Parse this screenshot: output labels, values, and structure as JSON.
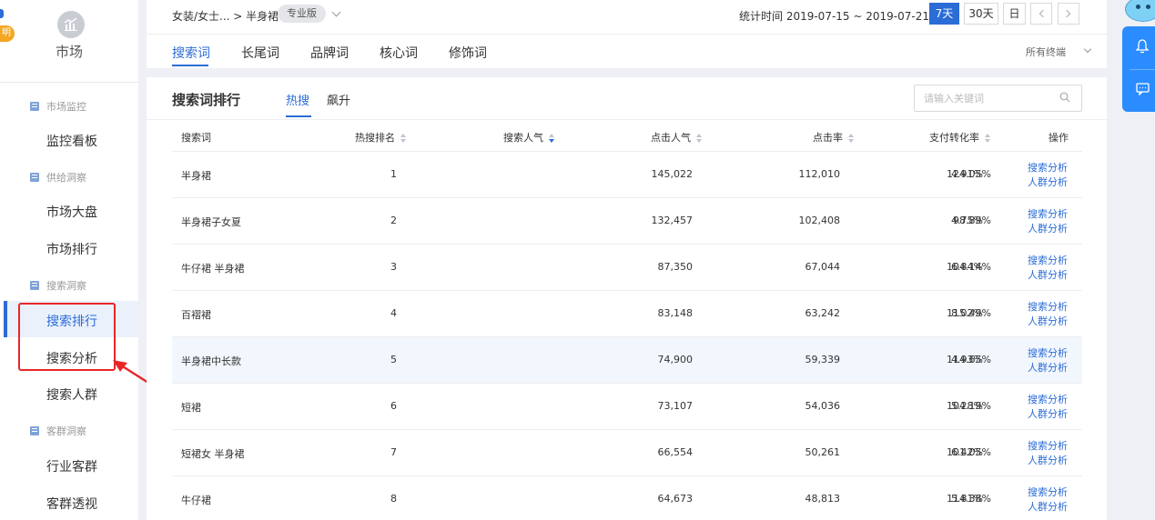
{
  "sidebar": {
    "badge": "明",
    "market_label": "市场",
    "groups": [
      "市场监控",
      "供给洞察",
      "搜索洞察",
      "客群洞察"
    ],
    "items": [
      "监控看板",
      "市场大盘",
      "市场排行",
      "搜索排行",
      "搜索分析",
      "搜索人群",
      "行业客群",
      "客群透视"
    ],
    "active_item": "搜索排行"
  },
  "header": {
    "breadcrumb": "女装/女士... > 半身裙",
    "edition": "专业版",
    "stat_time": "统计时间 2019-07-15 ~ 2019-07-21",
    "ranges": [
      "7天",
      "30天",
      "日"
    ],
    "active_range": "7天",
    "tabs": [
      "搜索词",
      "长尾词",
      "品牌词",
      "核心词",
      "修饰词"
    ],
    "active_tab": "搜索词",
    "terminals": "所有终端"
  },
  "panel": {
    "title": "搜索词排行",
    "subtabs": [
      "热搜",
      "飙升"
    ],
    "active_subtab": "热搜",
    "search_placeholder": "请输入关键词"
  },
  "table": {
    "columns": [
      "搜索词",
      "热搜排名",
      "搜索人气",
      "点击人气",
      "点击率",
      "支付转化率",
      "操作"
    ],
    "sort_column": "搜索人气",
    "action_labels": [
      "搜索分析",
      "人群分析"
    ],
    "rows": [
      {
        "term": "半身裙",
        "rank": "1",
        "search": "145,022",
        "click": "112,010",
        "ctr": "124.05%",
        "cvr": "4.91%"
      },
      {
        "term": "半身裙子女夏",
        "rank": "2",
        "search": "132,457",
        "click": "102,408",
        "ctr": "98.89%",
        "cvr": "4.75%"
      },
      {
        "term": "牛仔裙 半身裙",
        "rank": "3",
        "search": "87,350",
        "click": "67,044",
        "ctr": "104.14%",
        "cvr": "6.84%"
      },
      {
        "term": "百褶裙",
        "rank": "4",
        "search": "83,148",
        "click": "63,242",
        "ctr": "115.49%",
        "cvr": "8.02%"
      },
      {
        "term": "半身裙中长款",
        "rank": "5",
        "search": "74,900",
        "click": "59,339",
        "ctr": "114.65%",
        "cvr": "4.93%"
      },
      {
        "term": "短裙",
        "rank": "6",
        "search": "73,107",
        "click": "54,036",
        "ctr": "104.19%",
        "cvr": "5.28%"
      },
      {
        "term": "短裙女 半身裙",
        "rank": "7",
        "search": "66,554",
        "click": "50,261",
        "ctr": "101.05%",
        "cvr": "6.42%"
      },
      {
        "term": "牛仔裙",
        "rank": "8",
        "search": "64,673",
        "click": "48,813",
        "ctr": "114.38%",
        "cvr": "5.81%"
      }
    ],
    "highlighted_row": 5
  },
  "float_panel": {
    "icons": [
      "bell-icon",
      "message-icon"
    ]
  },
  "colors": {
    "accent": "#2b6cd6",
    "annotation": "#e8262a",
    "float": "#2b8cff"
  }
}
